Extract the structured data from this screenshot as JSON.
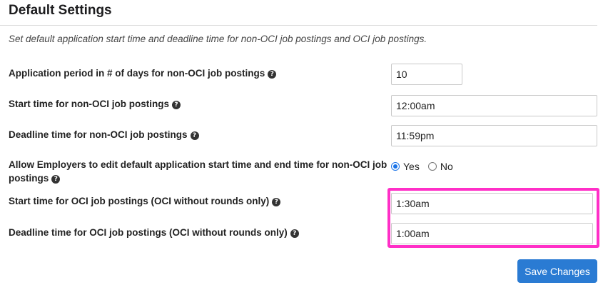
{
  "header": {
    "title": "Default Settings"
  },
  "description": "Set default application start time and deadline time for non-OCI job postings and OCI job postings.",
  "fields": {
    "application_period": {
      "label": "Application period in # of days for non-OCI job postings",
      "value": "10"
    },
    "start_non_oci": {
      "label": "Start time for non-OCI job postings",
      "value": "12:00am"
    },
    "deadline_non_oci": {
      "label": "Deadline time for non-OCI job postings",
      "value": "11:59pm"
    },
    "allow_edit": {
      "label_line1": "Allow Employers to edit default application start time and end time for non-OCI job",
      "label_line2": "postings",
      "options": [
        "Yes",
        "No"
      ],
      "selected": "Yes"
    },
    "start_oci": {
      "label": "Start time for OCI job postings (OCI without rounds only)",
      "value": "1:30am"
    },
    "deadline_oci": {
      "label": "Deadline time for OCI job postings (OCI without rounds only)",
      "value": "1:00am"
    }
  },
  "help_icon_glyph": "?",
  "save_button_label": "Save Changes",
  "colors": {
    "accent": "#2a7bd3",
    "highlight": "#ff2fc7"
  }
}
